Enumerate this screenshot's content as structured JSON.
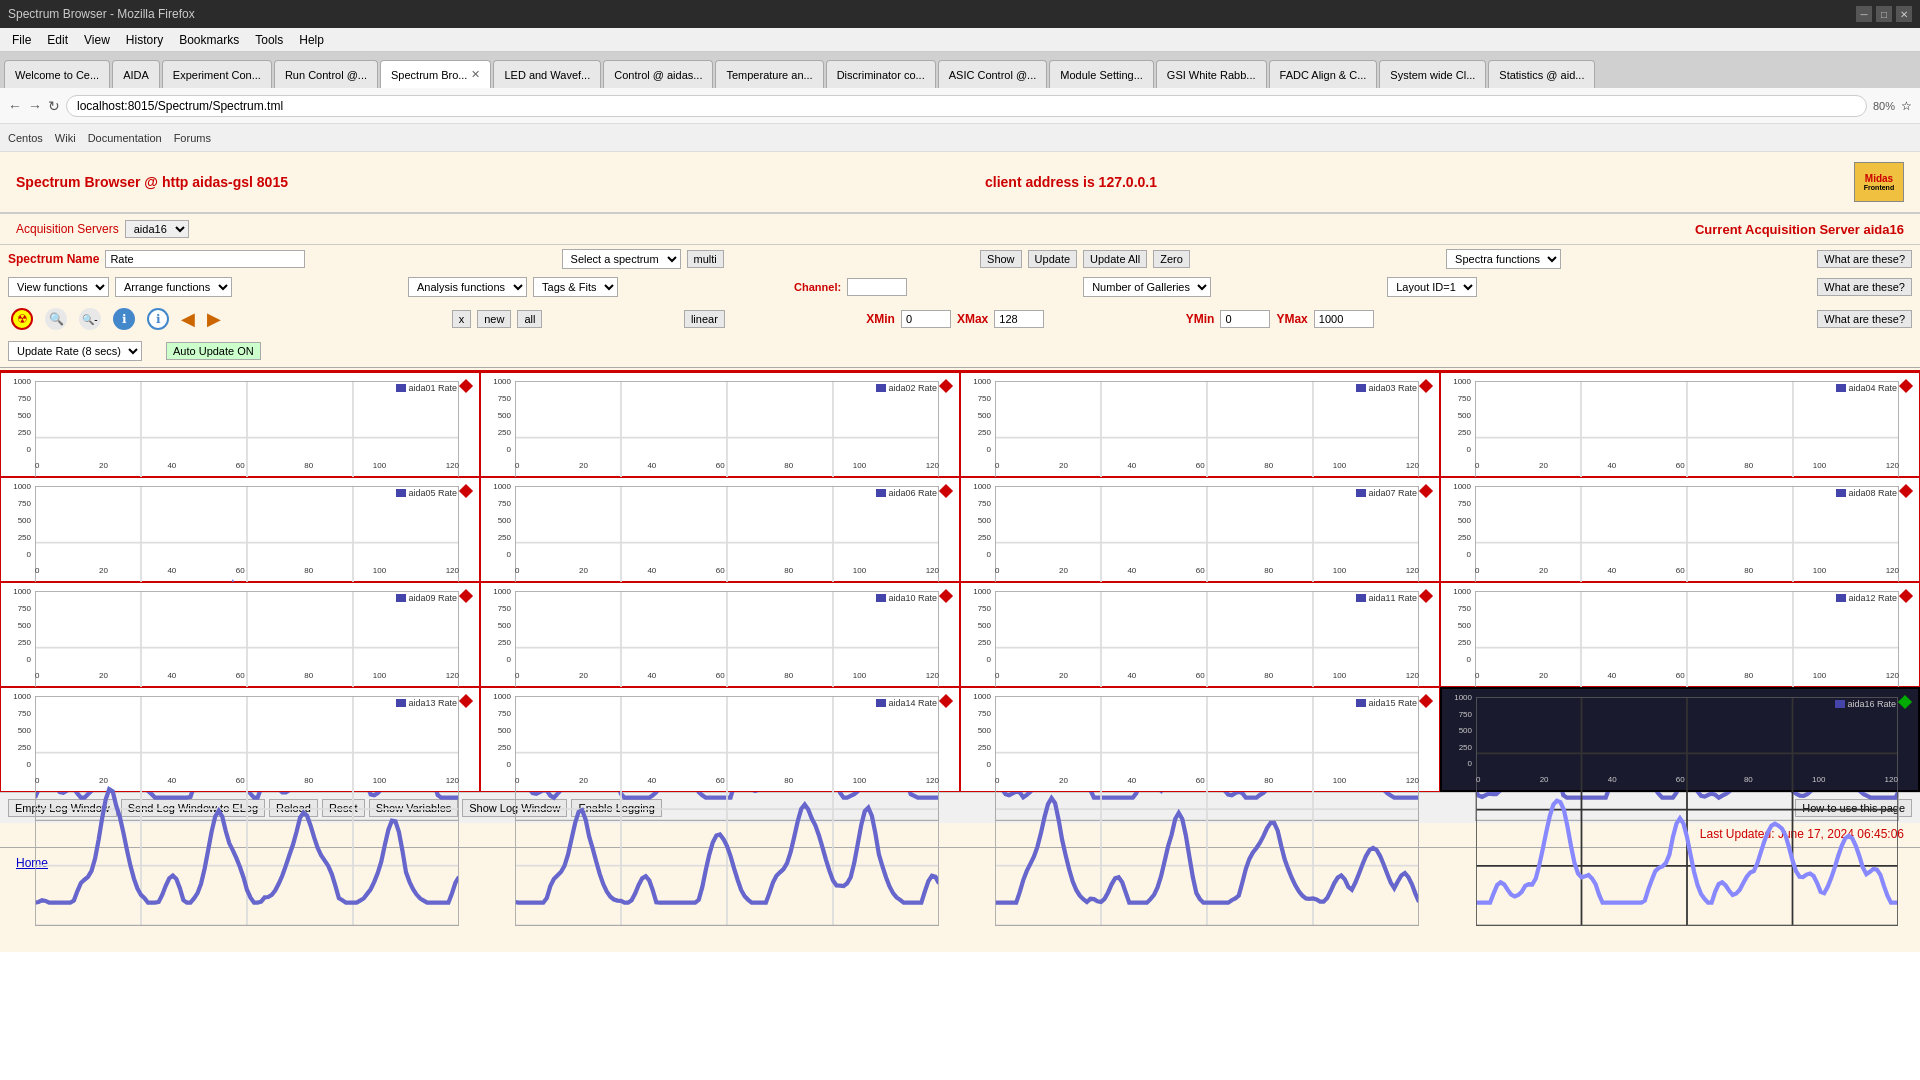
{
  "browser": {
    "title": "Spectrum Browser - Mozilla Firefox",
    "url": "localhost:8015/Spectrum/Spectrum.tml",
    "zoom": "80%",
    "tabs": [
      {
        "label": "Welcome to Ce...",
        "active": false
      },
      {
        "label": "AIDA",
        "active": false
      },
      {
        "label": "Experiment Con...",
        "active": false
      },
      {
        "label": "Run Control @...",
        "active": false
      },
      {
        "label": "Spectrum Bro...",
        "active": true,
        "closeable": true
      },
      {
        "label": "LED and Wavef...",
        "active": false
      },
      {
        "label": "Control @ aidas...",
        "active": false
      },
      {
        "label": "Temperature an...",
        "active": false
      },
      {
        "label": "Discriminator co...",
        "active": false
      },
      {
        "label": "ASIC Control @...",
        "active": false
      },
      {
        "label": "Module Setting...",
        "active": false
      },
      {
        "label": "GSI White Rabb...",
        "active": false
      },
      {
        "label": "FADC Align & C...",
        "active": false
      },
      {
        "label": "System wide Cl...",
        "active": false
      },
      {
        "label": "Statistics @ aid...",
        "active": false
      }
    ],
    "menu": [
      "File",
      "Edit",
      "View",
      "History",
      "Bookmarks",
      "Tools",
      "Help"
    ],
    "bookmarks": [
      "Centos",
      "Wiki",
      "Documentation",
      "Forums"
    ]
  },
  "page": {
    "title": "Spectrum Browser @ http aidas-gsl 8015",
    "client_address": "client address is 127.0.0.1",
    "acq_label": "Acquisition Servers",
    "acq_server": "aida16",
    "current_acq": "Current Acquisition Server aida16",
    "spectrum_name_label": "Spectrum Name",
    "spectrum_name_value": "Rate",
    "select_spectrum_label": "Select a spectrum",
    "multi_label": "multi",
    "show_btn": "Show",
    "update_btn": "Update",
    "update_all_btn": "Update All",
    "zero_btn": "Zero",
    "spectra_functions_label": "Spectra functions",
    "what_are_these_1": "What are these?",
    "what_are_these_2": "What are these?",
    "what_are_these_3": "What are these?",
    "view_functions_label": "View functions",
    "arrange_functions_label": "Arrange functions",
    "analysis_functions_label": "Analysis functions",
    "tags_fits_label": "Tags & Fits",
    "channel_label": "Channel:",
    "channel_value": "",
    "number_galleries_label": "Number of Galleries",
    "layout_label": "Layout ID=1",
    "x_btn": "x",
    "new_btn": "new",
    "all_btn": "all",
    "linear_btn": "linear",
    "xmin_label": "XMin",
    "xmin_value": "0",
    "xmax_label": "XMax",
    "xmax_value": "128",
    "ymin_label": "YMin",
    "ymin_value": "0",
    "ymax_label": "YMax",
    "ymax_value": "1000",
    "update_rate_label": "Update Rate (8 secs)",
    "auto_update_label": "Auto Update ON",
    "charts": [
      {
        "label": "aida01 Rate",
        "id": "aida01",
        "diamond": "red"
      },
      {
        "label": "aida02 Rate",
        "id": "aida02",
        "diamond": "red"
      },
      {
        "label": "aida03 Rate",
        "id": "aida03",
        "diamond": "red"
      },
      {
        "label": "aida04 Rate",
        "id": "aida04",
        "diamond": "red"
      },
      {
        "label": "aida05 Rate",
        "id": "aida05",
        "diamond": "red"
      },
      {
        "label": "aida06 Rate",
        "id": "aida06",
        "diamond": "red"
      },
      {
        "label": "aida07 Rate",
        "id": "aida07",
        "diamond": "red"
      },
      {
        "label": "aida08 Rate",
        "id": "aida08",
        "diamond": "red"
      },
      {
        "label": "aida09 Rate",
        "id": "aida09",
        "diamond": "red"
      },
      {
        "label": "aida10 Rate",
        "id": "aida10",
        "diamond": "red"
      },
      {
        "label": "aida11 Rate",
        "id": "aida11",
        "diamond": "red"
      },
      {
        "label": "aida12 Rate",
        "id": "aida12",
        "diamond": "red"
      },
      {
        "label": "aida13 Rate",
        "id": "aida13",
        "diamond": "red"
      },
      {
        "label": "aida14 Rate",
        "id": "aida14",
        "diamond": "red"
      },
      {
        "label": "aida15 Rate",
        "id": "aida15",
        "diamond": "red"
      },
      {
        "label": "aida16 Rate",
        "id": "aida16",
        "diamond": "green",
        "active": true
      }
    ],
    "footer_btns": [
      "Empty Log Window",
      "Send Log Window to ELog",
      "Reload",
      "Reset",
      "Show Variables",
      "Show Log Window",
      "Enable Logging"
    ],
    "how_to_btn": "How to use this page",
    "last_updated": "Last Updated: June 17, 2024 06:45:06",
    "home_link": "Home"
  }
}
